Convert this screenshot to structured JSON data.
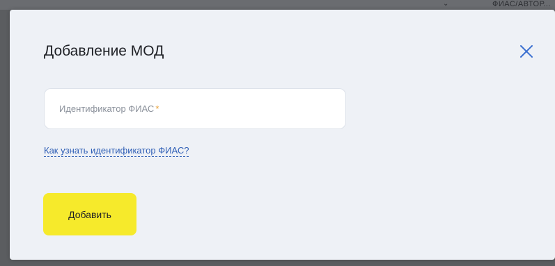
{
  "background": {
    "partial_text": "ФИАС/АВТОР..."
  },
  "modal": {
    "title": "Добавление МОД",
    "close_icon": "close-icon",
    "fias_field": {
      "placeholder": "Идентификатор ФИАС",
      "required_mark": "*",
      "value": ""
    },
    "help_link_label": "Как узнать идентификатор ФИАС?",
    "submit_label": "Добавить"
  },
  "colors": {
    "modal_background": "#eef1f6",
    "accent_button": "#f6ea2b",
    "link": "#2f5fb6",
    "required_mark": "#e8a23a"
  }
}
